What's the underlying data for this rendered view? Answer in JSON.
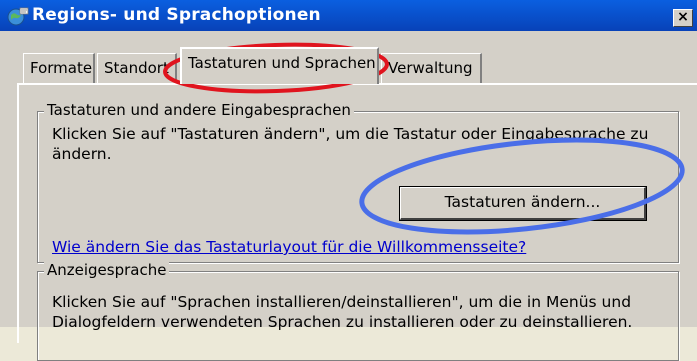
{
  "window": {
    "title": "Regions- und Sprachoptionen",
    "close_label": "×"
  },
  "tabs": [
    {
      "label": "Formate"
    },
    {
      "label": "Standort"
    },
    {
      "label": "Tastaturen und Sprachen",
      "active": true
    },
    {
      "label": "Verwaltung"
    }
  ],
  "keyboards_group": {
    "legend": "Tastaturen und andere Eingabesprachen",
    "description": "Klicken Sie auf \"Tastaturen ändern\", um die Tastatur oder Eingabesprache zu ändern.",
    "change_button": "Tastaturen ändern...",
    "welcome_link": "Wie ändern Sie das Tastaturlayout für die Willkommensseite?"
  },
  "display_group": {
    "legend": "Anzeigesprache",
    "description": "Klicken Sie auf \"Sprachen installieren/deinstallieren\", um die in Menüs und Dialogfeldern verwendeten Sprachen zu installieren oder zu deinstallieren."
  },
  "annotations": {
    "red_circle_color": "#e0141e",
    "blue_circle_color": "#4a6ee8"
  }
}
